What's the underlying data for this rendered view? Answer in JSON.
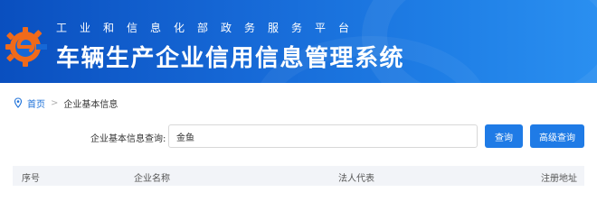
{
  "header": {
    "subtitle": "工业和信息化部政务服务平台",
    "title": "车辆生产企业信用信息管理系统",
    "logo_icon": "gear-e-logo-icon"
  },
  "breadcrumb": {
    "home": "首页",
    "separator": ">",
    "current": "企业基本信息"
  },
  "search": {
    "label": "企业基本信息查询:",
    "value": "金鱼",
    "query_button": "查询",
    "advanced_button": "高级查询"
  },
  "table": {
    "columns": [
      "序号",
      "企业名称",
      "法人代表",
      "注册地址"
    ]
  },
  "colors": {
    "header_blue": "#1668d6",
    "button_blue": "#1f7be6",
    "link_blue": "#1a6fd8",
    "logo_orange": "#f06a1a"
  }
}
